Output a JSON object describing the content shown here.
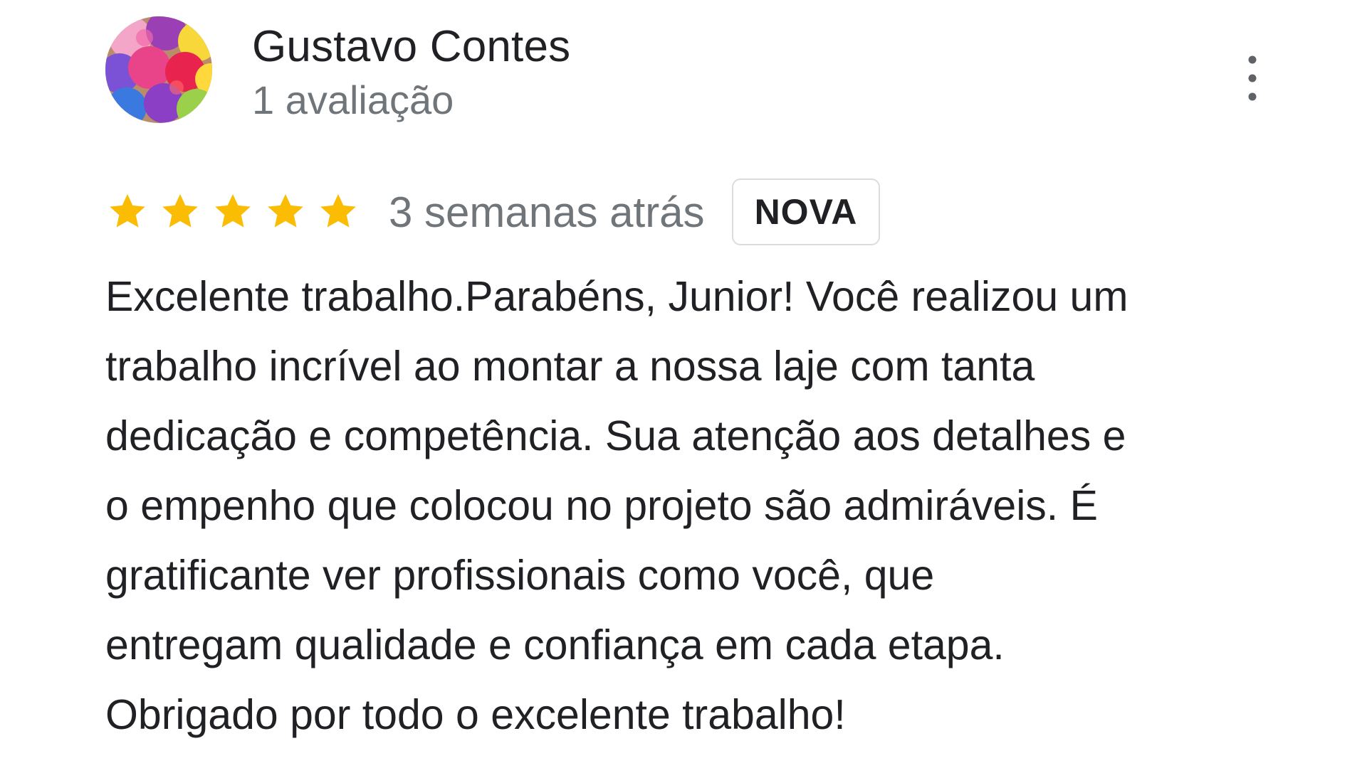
{
  "reviewer": {
    "name": "Gustavo Contes",
    "meta": "1 avaliação",
    "avatar_icon": "yarn-balls-avatar"
  },
  "menu": {
    "icon": "more-vert-icon"
  },
  "rating": {
    "stars": 5,
    "max_stars": 5,
    "star_color": "#fbbc04"
  },
  "review": {
    "date": "3 semanas atrás",
    "badge": "NOVA",
    "text_lines": [
      "Excelente trabalho.Parabéns, Junior! Você realizou um",
      "trabalho incrível ao montar a nossa laje com tanta",
      "dedicação e competência. Sua atenção aos detalhes e",
      "o empenho que colocou no projeto são admiráveis. É",
      "gratificante ver profissionais como você, que",
      "entregam qualidade e confiança em cada etapa.",
      "Obrigado por todo o excelente trabalho!"
    ]
  },
  "colors": {
    "primary_text": "#202124",
    "secondary_text": "#70757a",
    "badge_border": "#dadce0"
  }
}
